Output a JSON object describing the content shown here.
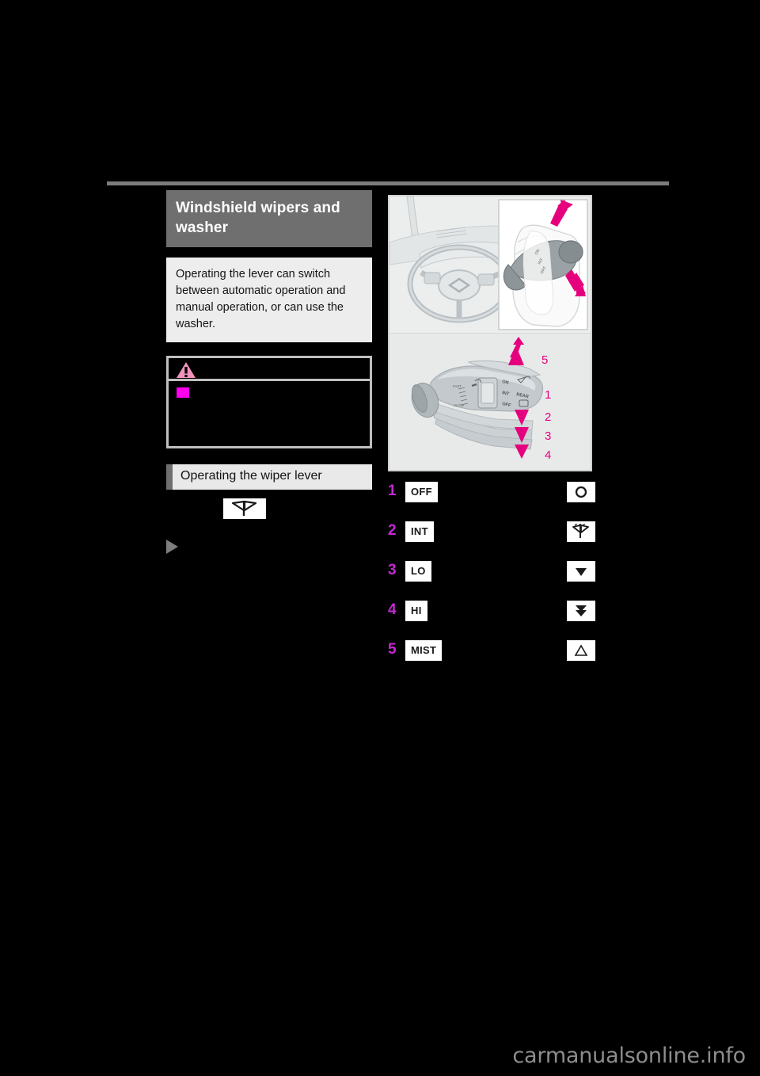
{
  "document": {
    "section_title": "Windshield wipers and washer",
    "lead_paragraph": "Operating the lever can switch between automatic operation and manual operation, or can use the washer.",
    "caution": {
      "icon": "warning-triangle-icon",
      "bullet": "square-bullet",
      "text": ""
    },
    "subsection_title": "Operating the wiper lever",
    "wiper_icon_caption": "",
    "marker_text": "",
    "watermark": "carmanualsonline.info"
  },
  "illustration": {
    "top": {
      "name": "steering-wheel-and-lever-photo",
      "inset_name": "hand-operating-lever-inset",
      "arrows": [
        "up-arrow",
        "down-arrow"
      ]
    },
    "bottom": {
      "name": "wiper-lever-diagram",
      "callouts": [
        "5",
        "1",
        "2",
        "3",
        "4"
      ],
      "lever_labels": [
        "ON",
        "INT",
        "OFF",
        "REAR"
      ]
    }
  },
  "modes": [
    {
      "number": "1",
      "label": "OFF",
      "description": "",
      "symbol": "circle-icon",
      "symbol_glyph": "O"
    },
    {
      "number": "2",
      "label": "INT",
      "description": "",
      "symbol": "wiper-icon",
      "symbol_glyph": ""
    },
    {
      "number": "3",
      "label": "LO",
      "description": "",
      "symbol": "down-triangle-icon",
      "symbol_glyph": "▼"
    },
    {
      "number": "4",
      "label": "HI",
      "description": "",
      "symbol": "double-down-arrow-icon",
      "symbol_glyph": ""
    },
    {
      "number": "5",
      "label": "MIST",
      "description": "",
      "symbol": "up-triangle-outline-icon",
      "symbol_glyph": "△"
    }
  ],
  "colors": {
    "accent_magenta": "#e5007e",
    "callout_purple": "#c42ad4",
    "bullet_magenta": "#ff00ee",
    "header_gray": "#6f6f6f",
    "panel_gray": "#ededed",
    "page_black": "#000000"
  }
}
